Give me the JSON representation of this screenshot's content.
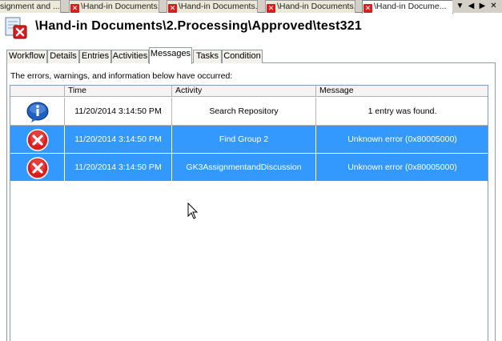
{
  "doc_tabs": [
    {
      "label": "signment and ...",
      "has_icon": false
    },
    {
      "label": "\\Hand-in Documents...",
      "has_icon": true
    },
    {
      "label": "\\Hand-in Documents...",
      "has_icon": true
    },
    {
      "label": "\\Hand-in Documents...",
      "has_icon": true
    },
    {
      "label": "\\Hand-in Docume...",
      "has_icon": true,
      "active": true
    }
  ],
  "strip_controls": [
    "▼",
    "◀",
    "▶",
    "✕"
  ],
  "document": {
    "title": "\\Hand-in Documents\\2.Processing\\Approved\\test321"
  },
  "inner_tabs": [
    "Workflow",
    "Details",
    "Entries",
    "Activities",
    "Messages",
    "Tasks",
    "Condition"
  ],
  "active_inner_tab": "Messages",
  "messages_intro": "The errors, warnings, and information below have occurred:",
  "grid": {
    "columns": [
      "",
      "Time",
      "Activity",
      "Message"
    ],
    "rows": [
      {
        "type": "info",
        "time": "11/20/2014 3:14:50 PM",
        "activity": "Search Repository",
        "message": "1 entry was found.",
        "selected": false
      },
      {
        "type": "error",
        "time": "11/20/2014 3:14:50 PM",
        "activity": "Find Group 2",
        "message": "Unknown error (0x80005000)",
        "selected": true
      },
      {
        "type": "error",
        "time": "11/20/2014 3:14:50 PM",
        "activity": "GK3AssignmentandDiscussion",
        "message": "Unknown error (0x80005000)",
        "selected": true
      }
    ]
  },
  "colors": {
    "selection": "#3399ff",
    "error_red": "#d81e1e",
    "info_blue": "#1f5fbf"
  }
}
